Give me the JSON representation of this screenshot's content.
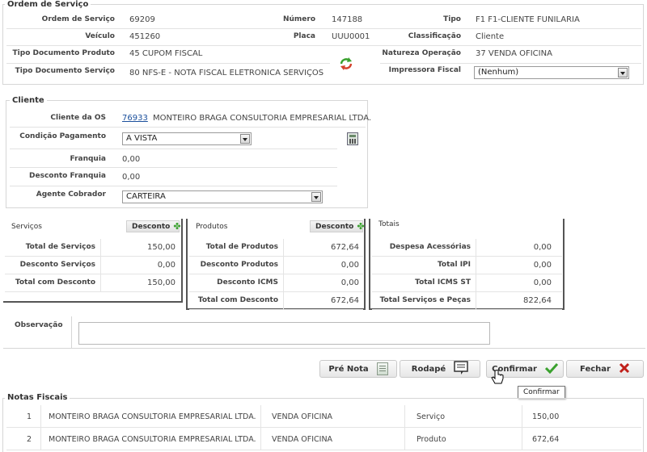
{
  "ordem": {
    "legend": "Ordem de Serviço",
    "ordem_servico_label": "Ordem de Serviço",
    "ordem_servico_value": "69209",
    "numero_label": "Número",
    "numero_value": "147188",
    "tipo_label": "Tipo",
    "tipo_value": "F1  F1-CLIENTE FUNILARIA",
    "veiculo_label": "Veículo",
    "veiculo_value": "451260",
    "placa_label": "Placa",
    "placa_value": "UUU0001",
    "classificacao_label": "Classificação",
    "classificacao_value": "Cliente",
    "tipo_doc_produto_label": "Tipo Documento Produto",
    "tipo_doc_produto_value": "45  CUPOM FISCAL",
    "natureza_label": "Natureza Operação",
    "natureza_value": "37  VENDA OFICINA",
    "tipo_doc_servico_label": "Tipo Documento Serviço",
    "tipo_doc_servico_value": "80  NFS-E - NOTA FISCAL ELETRONICA SERVIÇOS",
    "impressora_label": "Impressora Fiscal",
    "impressora_value": "(Nenhum)"
  },
  "cliente": {
    "legend": "Cliente",
    "cliente_os_label": "Cliente da OS",
    "cliente_code": "76933",
    "cliente_name": "MONTEIRO BRAGA CONSULTORIA EMPRESARIAL LTDA.",
    "condicao_label": "Condição Pagamento",
    "condicao_value": "A VISTA",
    "franquia_label": "Franquia",
    "franquia_value": "0,00",
    "desconto_franquia_label": "Desconto Franquia",
    "desconto_franquia_value": "0,00",
    "agente_label": "Agente Cobrador",
    "agente_value": "CARTEIRA"
  },
  "servicos": {
    "title": "Serviços",
    "desconto_btn": "Desconto",
    "rows": [
      {
        "label": "Total de Serviços",
        "value": "150,00"
      },
      {
        "label": "Desconto Serviços",
        "value": "0,00"
      },
      {
        "label": "Total com Desconto",
        "value": "150,00"
      }
    ]
  },
  "produtos": {
    "title": "Produtos",
    "desconto_btn": "Desconto",
    "rows": [
      {
        "label": "Total de Produtos",
        "value": "672,64"
      },
      {
        "label": "Desconto Produtos",
        "value": "0,00"
      },
      {
        "label": "Desconto ICMS",
        "value": "0,00"
      },
      {
        "label": "Total com Desconto",
        "value": "672,64"
      }
    ]
  },
  "totais": {
    "title": "Totais",
    "rows": [
      {
        "label": "Despesa Acessórias",
        "value": "0,00"
      },
      {
        "label": "Total IPI",
        "value": "0,00"
      },
      {
        "label": "Total ICMS ST",
        "value": "0,00"
      },
      {
        "label": "Total Serviços e Peças",
        "value": "822,64"
      }
    ]
  },
  "observacao": {
    "label": "Observação",
    "value": ""
  },
  "actions": {
    "pre_nota": "Pré Nota",
    "rodape": "Rodapé",
    "confirmar": "Confirmar",
    "fechar": "Fechar",
    "tooltip": "Confirmar"
  },
  "notas": {
    "legend": "Notas Fiscais",
    "rows": [
      {
        "num": "1",
        "cliente": "MONTEIRO BRAGA CONSULTORIA EMPRESARIAL LTDA.",
        "natureza": "VENDA OFICINA",
        "tipo": "Serviço",
        "valor": "150,00"
      },
      {
        "num": "2",
        "cliente": "MONTEIRO BRAGA CONSULTORIA EMPRESARIAL LTDA.",
        "natureza": "VENDA OFICINA",
        "tipo": "Produto",
        "valor": "672,64"
      }
    ]
  },
  "colors": {
    "link": "#1a4f9c",
    "check_green": "#3aa12e",
    "close_red": "#c0201a",
    "border": "#d6d6d6"
  }
}
